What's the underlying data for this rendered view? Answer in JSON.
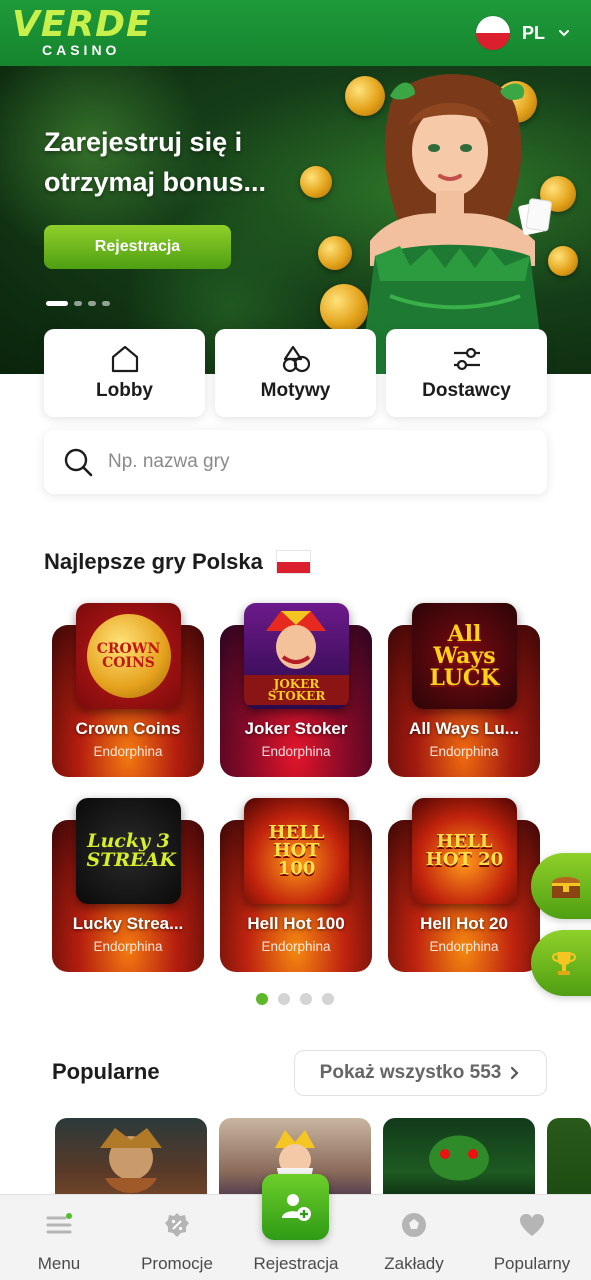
{
  "header": {
    "logo_top": "VERDE",
    "logo_bottom": "CASINO",
    "language": "PL",
    "flag_icon": "poland-flag-icon"
  },
  "hero": {
    "title": "Zarejestruj się i otrzymaj bonus...",
    "cta_label": "Rejestracja",
    "slides_total": 4,
    "slide_active": 1
  },
  "categories": [
    {
      "label": "Lobby",
      "icon": "home-icon"
    },
    {
      "label": "Motywy",
      "icon": "shapes-icon"
    },
    {
      "label": "Dostawcy",
      "icon": "sliders-icon"
    }
  ],
  "search": {
    "placeholder": "Np. nazwa gry"
  },
  "top_games": {
    "title": "Najlepsze gry Polska",
    "games": [
      {
        "name": "Crown Coins",
        "provider": "Endorphina",
        "logo": "CROWN COINS"
      },
      {
        "name": "Joker Stoker",
        "provider": "Endorphina",
        "logo": "JOKER STOKER"
      },
      {
        "name": "All Ways Lu...",
        "provider": "Endorphina",
        "logo": "All Ways LUCK"
      },
      {
        "name": "Lucky Strea...",
        "provider": "Endorphina",
        "logo": "Lucky 3 STREAK"
      },
      {
        "name": "Hell Hot 100",
        "provider": "Endorphina",
        "logo": "HELL HOT 100"
      },
      {
        "name": "Hell Hot 20",
        "provider": "Endorphina",
        "logo": "HELL HOT 20"
      }
    ],
    "pages_total": 4,
    "page_active": 1
  },
  "popular": {
    "title": "Popularne",
    "show_all_label": "Pokaż wszystko 553"
  },
  "side_buttons": [
    {
      "icon": "treasure-chest-icon"
    },
    {
      "icon": "trophy-icon"
    }
  ],
  "bottom_nav": [
    {
      "label": "Menu",
      "icon": "menu-icon"
    },
    {
      "label": "Promocje",
      "icon": "promo-badge-icon"
    },
    {
      "label": "Rejestracja",
      "icon": "add-user-icon"
    },
    {
      "label": "Zakłady",
      "icon": "football-icon"
    },
    {
      "label": "Popularny",
      "icon": "heart-icon"
    }
  ],
  "colors": {
    "brand_green": "#1f9a3a",
    "accent_lime": "#8fd02a",
    "logo_lime": "#c8f04a"
  }
}
